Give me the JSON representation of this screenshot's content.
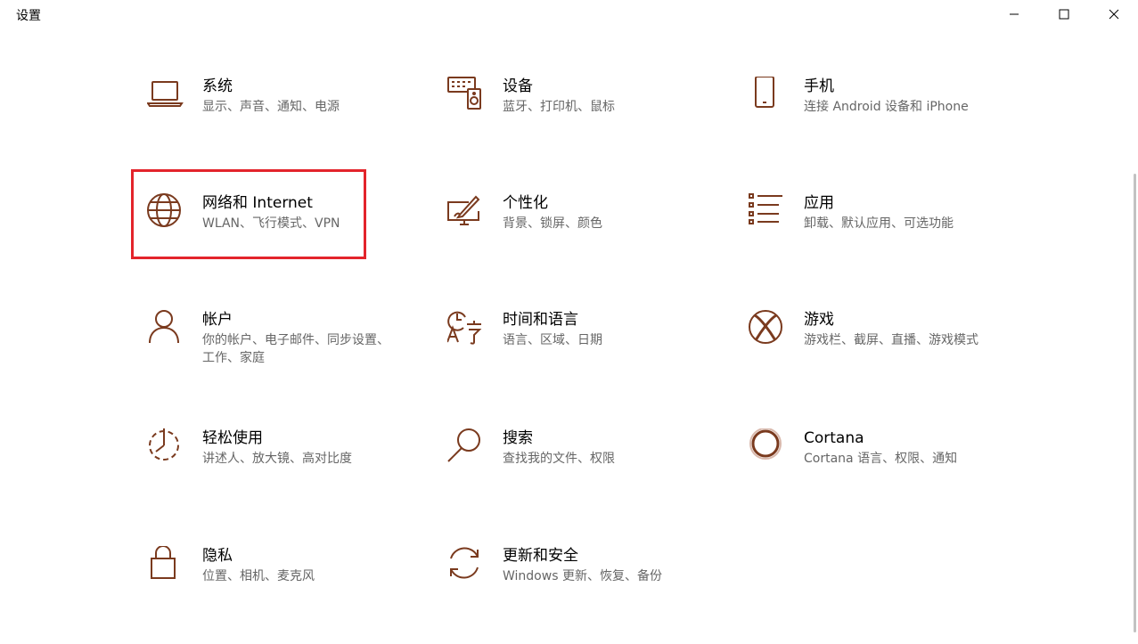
{
  "window": {
    "title": "设置"
  },
  "colors": {
    "accent": "#7a3a1e",
    "highlight": "#e3242b",
    "desc": "#666666"
  },
  "tiles": [
    {
      "name": "系统",
      "desc": "显示、声音、通知、电源",
      "icon": "laptop-icon"
    },
    {
      "name": "设备",
      "desc": "蓝牙、打印机、鼠标",
      "icon": "devices-icon"
    },
    {
      "name": "手机",
      "desc": "连接 Android 设备和 iPhone",
      "icon": "phone-icon"
    },
    {
      "name": "网络和 Internet",
      "desc": "WLAN、飞行模式、VPN",
      "icon": "globe-icon",
      "highlighted": true
    },
    {
      "name": "个性化",
      "desc": "背景、锁屏、颜色",
      "icon": "personalization-icon"
    },
    {
      "name": "应用",
      "desc": "卸载、默认应用、可选功能",
      "icon": "apps-list-icon"
    },
    {
      "name": "帐户",
      "desc": "你的帐户、电子邮件、同步设置、工作、家庭",
      "icon": "person-icon"
    },
    {
      "name": "时间和语言",
      "desc": "语言、区域、日期",
      "icon": "time-language-icon"
    },
    {
      "name": "游戏",
      "desc": "游戏栏、截屏、直播、游戏模式",
      "icon": "xbox-icon"
    },
    {
      "name": "轻松使用",
      "desc": "讲述人、放大镜、高对比度",
      "icon": "ease-of-access-icon"
    },
    {
      "name": "搜索",
      "desc": "查找我的文件、权限",
      "icon": "search-icon"
    },
    {
      "name": "Cortana",
      "desc": "Cortana 语言、权限、通知",
      "icon": "cortana-icon"
    },
    {
      "name": "隐私",
      "desc": "位置、相机、麦克风",
      "icon": "lock-icon"
    },
    {
      "name": "更新和安全",
      "desc": "Windows 更新、恢复、备份",
      "icon": "update-icon"
    }
  ]
}
